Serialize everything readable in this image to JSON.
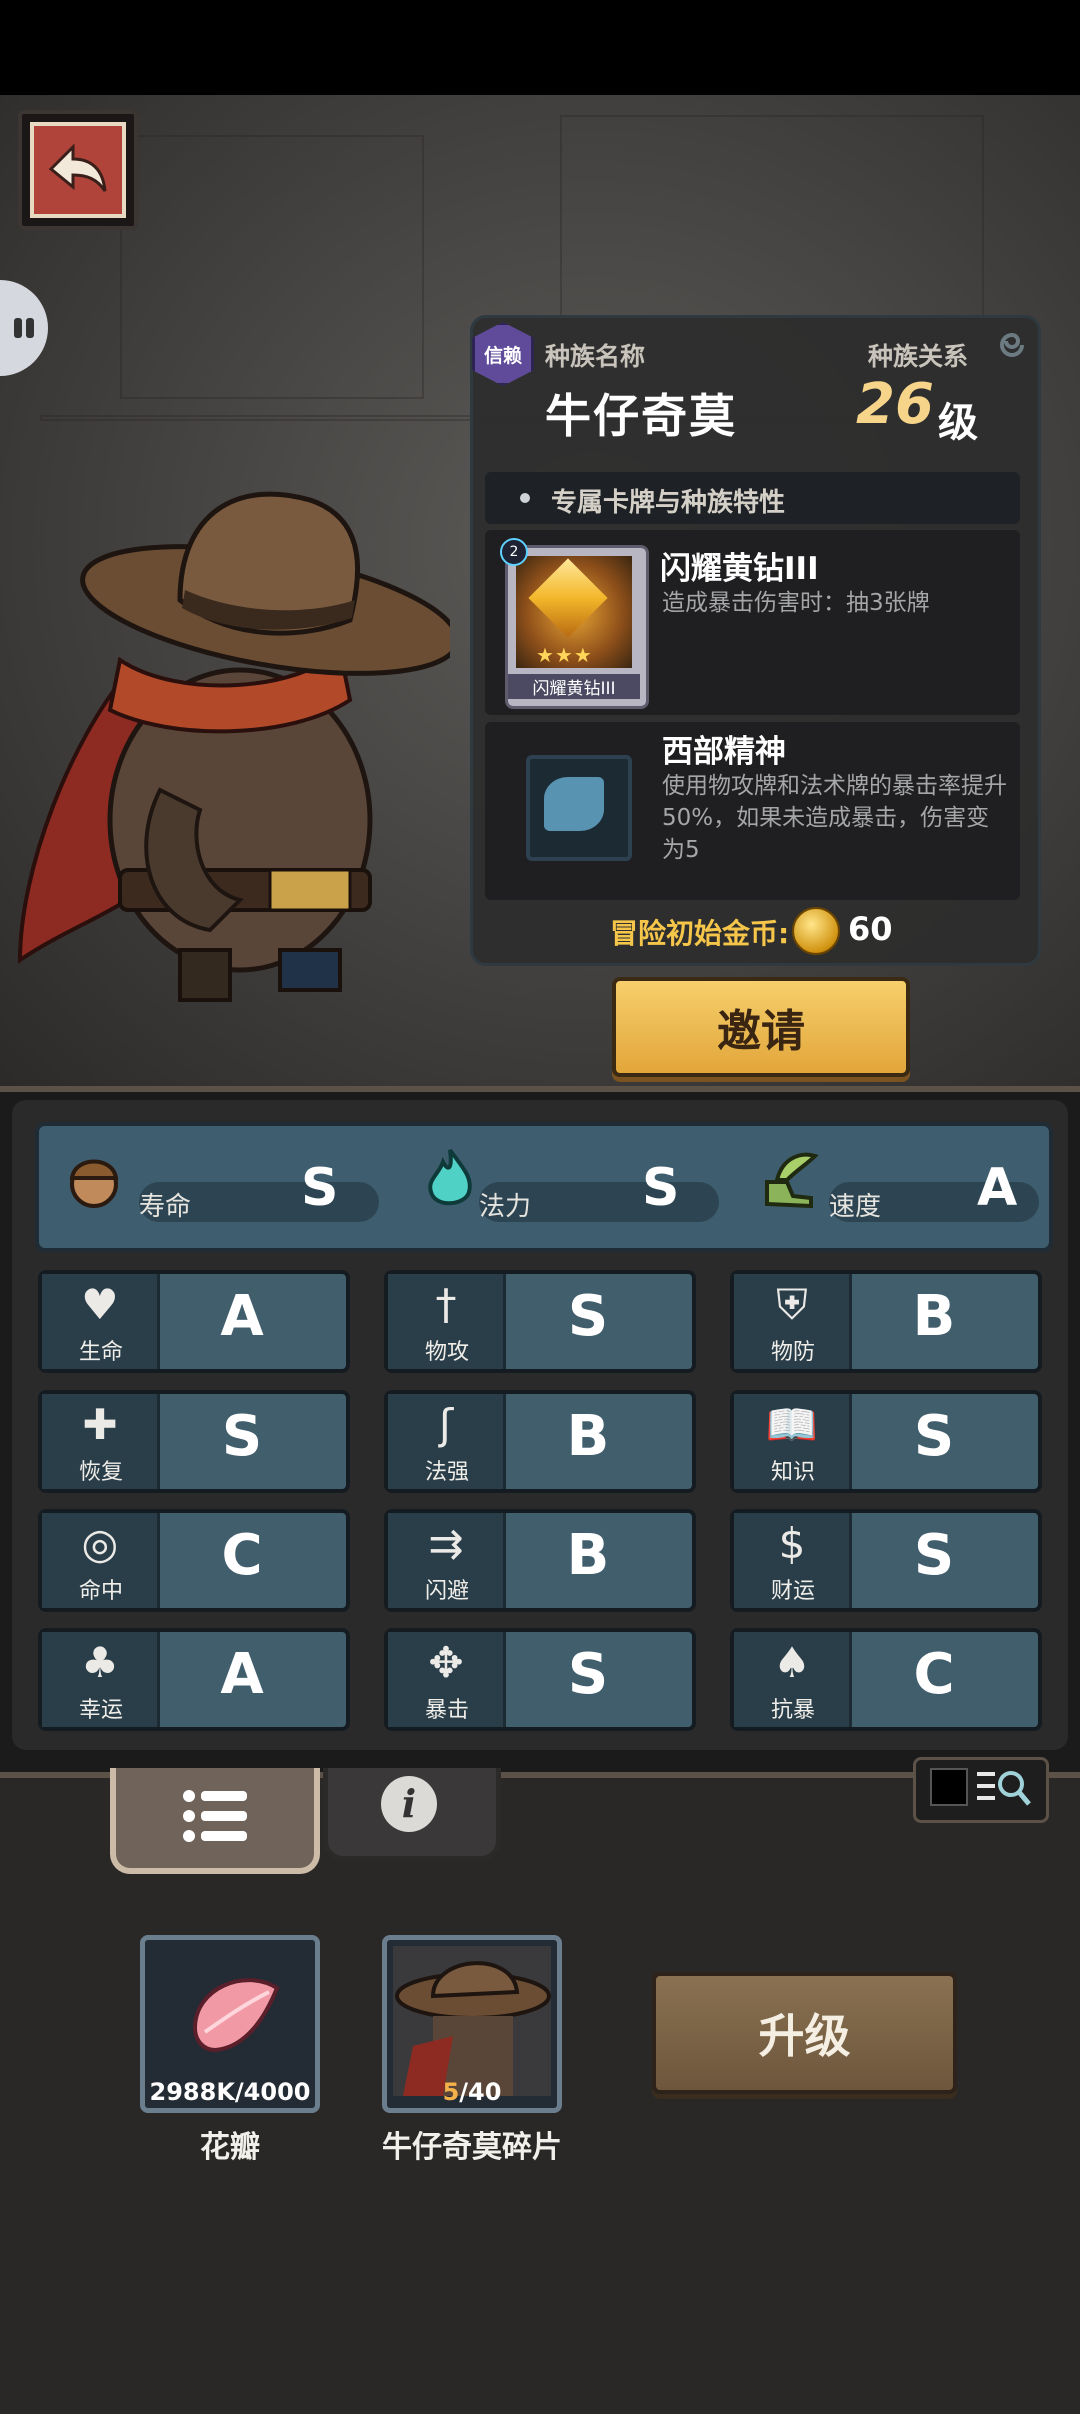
{
  "race": {
    "trust_badge": "信赖",
    "name_label": "种族名称",
    "relation_label": "种族关系",
    "name": "牛仔奇莫",
    "level": "26",
    "level_unit": "级"
  },
  "section_title": "专属卡牌与种族特性",
  "card": {
    "title": "闪耀黄钻III",
    "desc": "造成暴击伤害时：抽3张牌",
    "art_caption": "闪耀黄钻III",
    "badge": "2",
    "stars": "★★★"
  },
  "trait": {
    "title": "西部精神",
    "desc": "使用物攻牌和法术牌的暴击率提升50%，如果未造成暴击，伤害变为5"
  },
  "starting_gold": {
    "label": "冒险初始金币:",
    "value": "60"
  },
  "invite_label": "邀请",
  "top_stats": [
    {
      "icon": "lifespan-icon",
      "label": "寿命",
      "grade": "S"
    },
    {
      "icon": "mana-flame-icon",
      "label": "法力",
      "grade": "S"
    },
    {
      "icon": "winged-boot-icon",
      "label": "速度",
      "grade": "A"
    }
  ],
  "stats": [
    {
      "icon": "heart-icon",
      "label": "生命",
      "grade": "A"
    },
    {
      "icon": "sword-icon",
      "label": "物攻",
      "grade": "S"
    },
    {
      "icon": "armor-icon",
      "label": "物防",
      "grade": "B"
    },
    {
      "icon": "heal-heart-icon",
      "label": "恢复",
      "grade": "S"
    },
    {
      "icon": "staff-icon",
      "label": "法强",
      "grade": "B"
    },
    {
      "icon": "book-icon",
      "label": "知识",
      "grade": "S"
    },
    {
      "icon": "target-icon",
      "label": "命中",
      "grade": "C"
    },
    {
      "icon": "dodge-arrows-icon",
      "label": "闪避",
      "grade": "B"
    },
    {
      "icon": "coin-icon",
      "label": "财运",
      "grade": "S"
    },
    {
      "icon": "clover-icon",
      "label": "幸运",
      "grade": "A"
    },
    {
      "icon": "crit-icon",
      "label": "暴击",
      "grade": "S"
    },
    {
      "icon": "crit-resist-icon",
      "label": "抗暴",
      "grade": "C"
    }
  ],
  "materials": [
    {
      "icon": "petal-icon",
      "count": "2988K/4000",
      "name": "花瓣"
    },
    {
      "icon": "cowboy-portrait-icon",
      "count_have": "5",
      "count_need": "/40",
      "name": "牛仔奇莫碎片"
    }
  ],
  "upgrade_label": "升级",
  "colors": {
    "panel_teal": "#415e6d",
    "gold_text": "#f5c64a",
    "invite_button": "#f0c35c",
    "upgrade_button": "#7d6447",
    "level_gold": "#f6d58a"
  }
}
